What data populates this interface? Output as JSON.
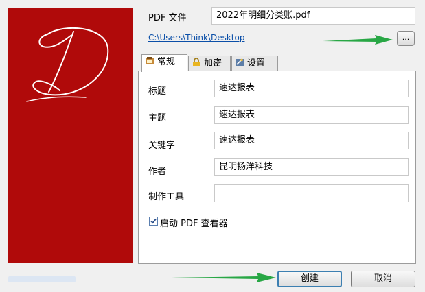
{
  "file": {
    "label": "PDF 文件",
    "name": "2022年明细分类账.pdf",
    "path": "C:\\Users\\Think\\Desktop",
    "browse_label": "..."
  },
  "tabs": [
    {
      "label": "常规",
      "icon": "general-icon",
      "active": true
    },
    {
      "label": "加密",
      "icon": "lock-icon",
      "active": false
    },
    {
      "label": "设置",
      "icon": "settings-icon",
      "active": false
    }
  ],
  "general": {
    "title_label": "标题",
    "title_value": "速达报表",
    "subject_label": "主题",
    "subject_value": "速达报表",
    "keywords_label": "关键字",
    "keywords_value": "速达报表",
    "author_label": "作者",
    "author_value": "昆明扬洋科技",
    "creator_label": "制作工具",
    "creator_value": "",
    "viewer_label": "启动 PDF 查看器",
    "viewer_checked": true
  },
  "buttons": {
    "create": "创建",
    "cancel": "取消"
  },
  "colors": {
    "brand": "#b00a0a",
    "arrow": "#28a745",
    "link": "#0b4fa8"
  }
}
